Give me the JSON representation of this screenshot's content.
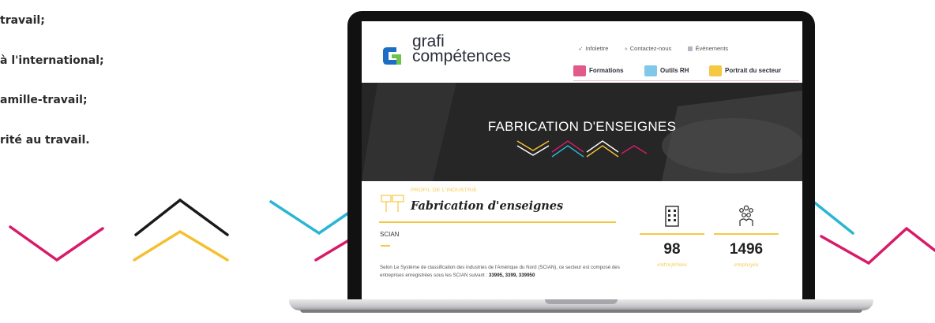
{
  "left_list": {
    "items": [
      "travail;",
      "à l'international;",
      "amille-travail;",
      "rité au travail."
    ]
  },
  "site": {
    "logo": {
      "line1": "grafi",
      "line2": "compétences"
    },
    "top_links": {
      "newsletter": "Infolettre",
      "contact": "Contactez-nous",
      "events": "Événements"
    },
    "nav": {
      "formations": "Formations",
      "outils": "Outils RH",
      "portrait": "Portrait du secteur"
    },
    "hero": {
      "title": "FABRICATION D'ENSEIGNES"
    },
    "profile": {
      "label": "PROFIL DE L'INDUSTRIE",
      "title": "Fabrication d'enseignes",
      "scian_label": "SCIAN",
      "description": "Selon Le Système de classification des industries de l'Amérique du Nord (SCIAN), ce secteur est composé des entreprises enregistrées sous les SCIAN suivant :",
      "codes": "33995, 3399, 339950"
    },
    "stats": [
      {
        "value": "98",
        "label": "entreprises"
      },
      {
        "value": "1496",
        "label": "employés"
      }
    ]
  },
  "colors": {
    "pink": "#d81b68",
    "black": "#1a1a1a",
    "yellow": "#f5c030",
    "cyan": "#29b6d4",
    "logo_blue": "#1b6ec2",
    "logo_green": "#6cc24a"
  },
  "icons": [
    "send-icon",
    "chevrons-icon",
    "calendar-icon",
    "formations-icon",
    "outils-icon",
    "portrait-icon",
    "building-icon",
    "people-icon",
    "sign-icon"
  ]
}
